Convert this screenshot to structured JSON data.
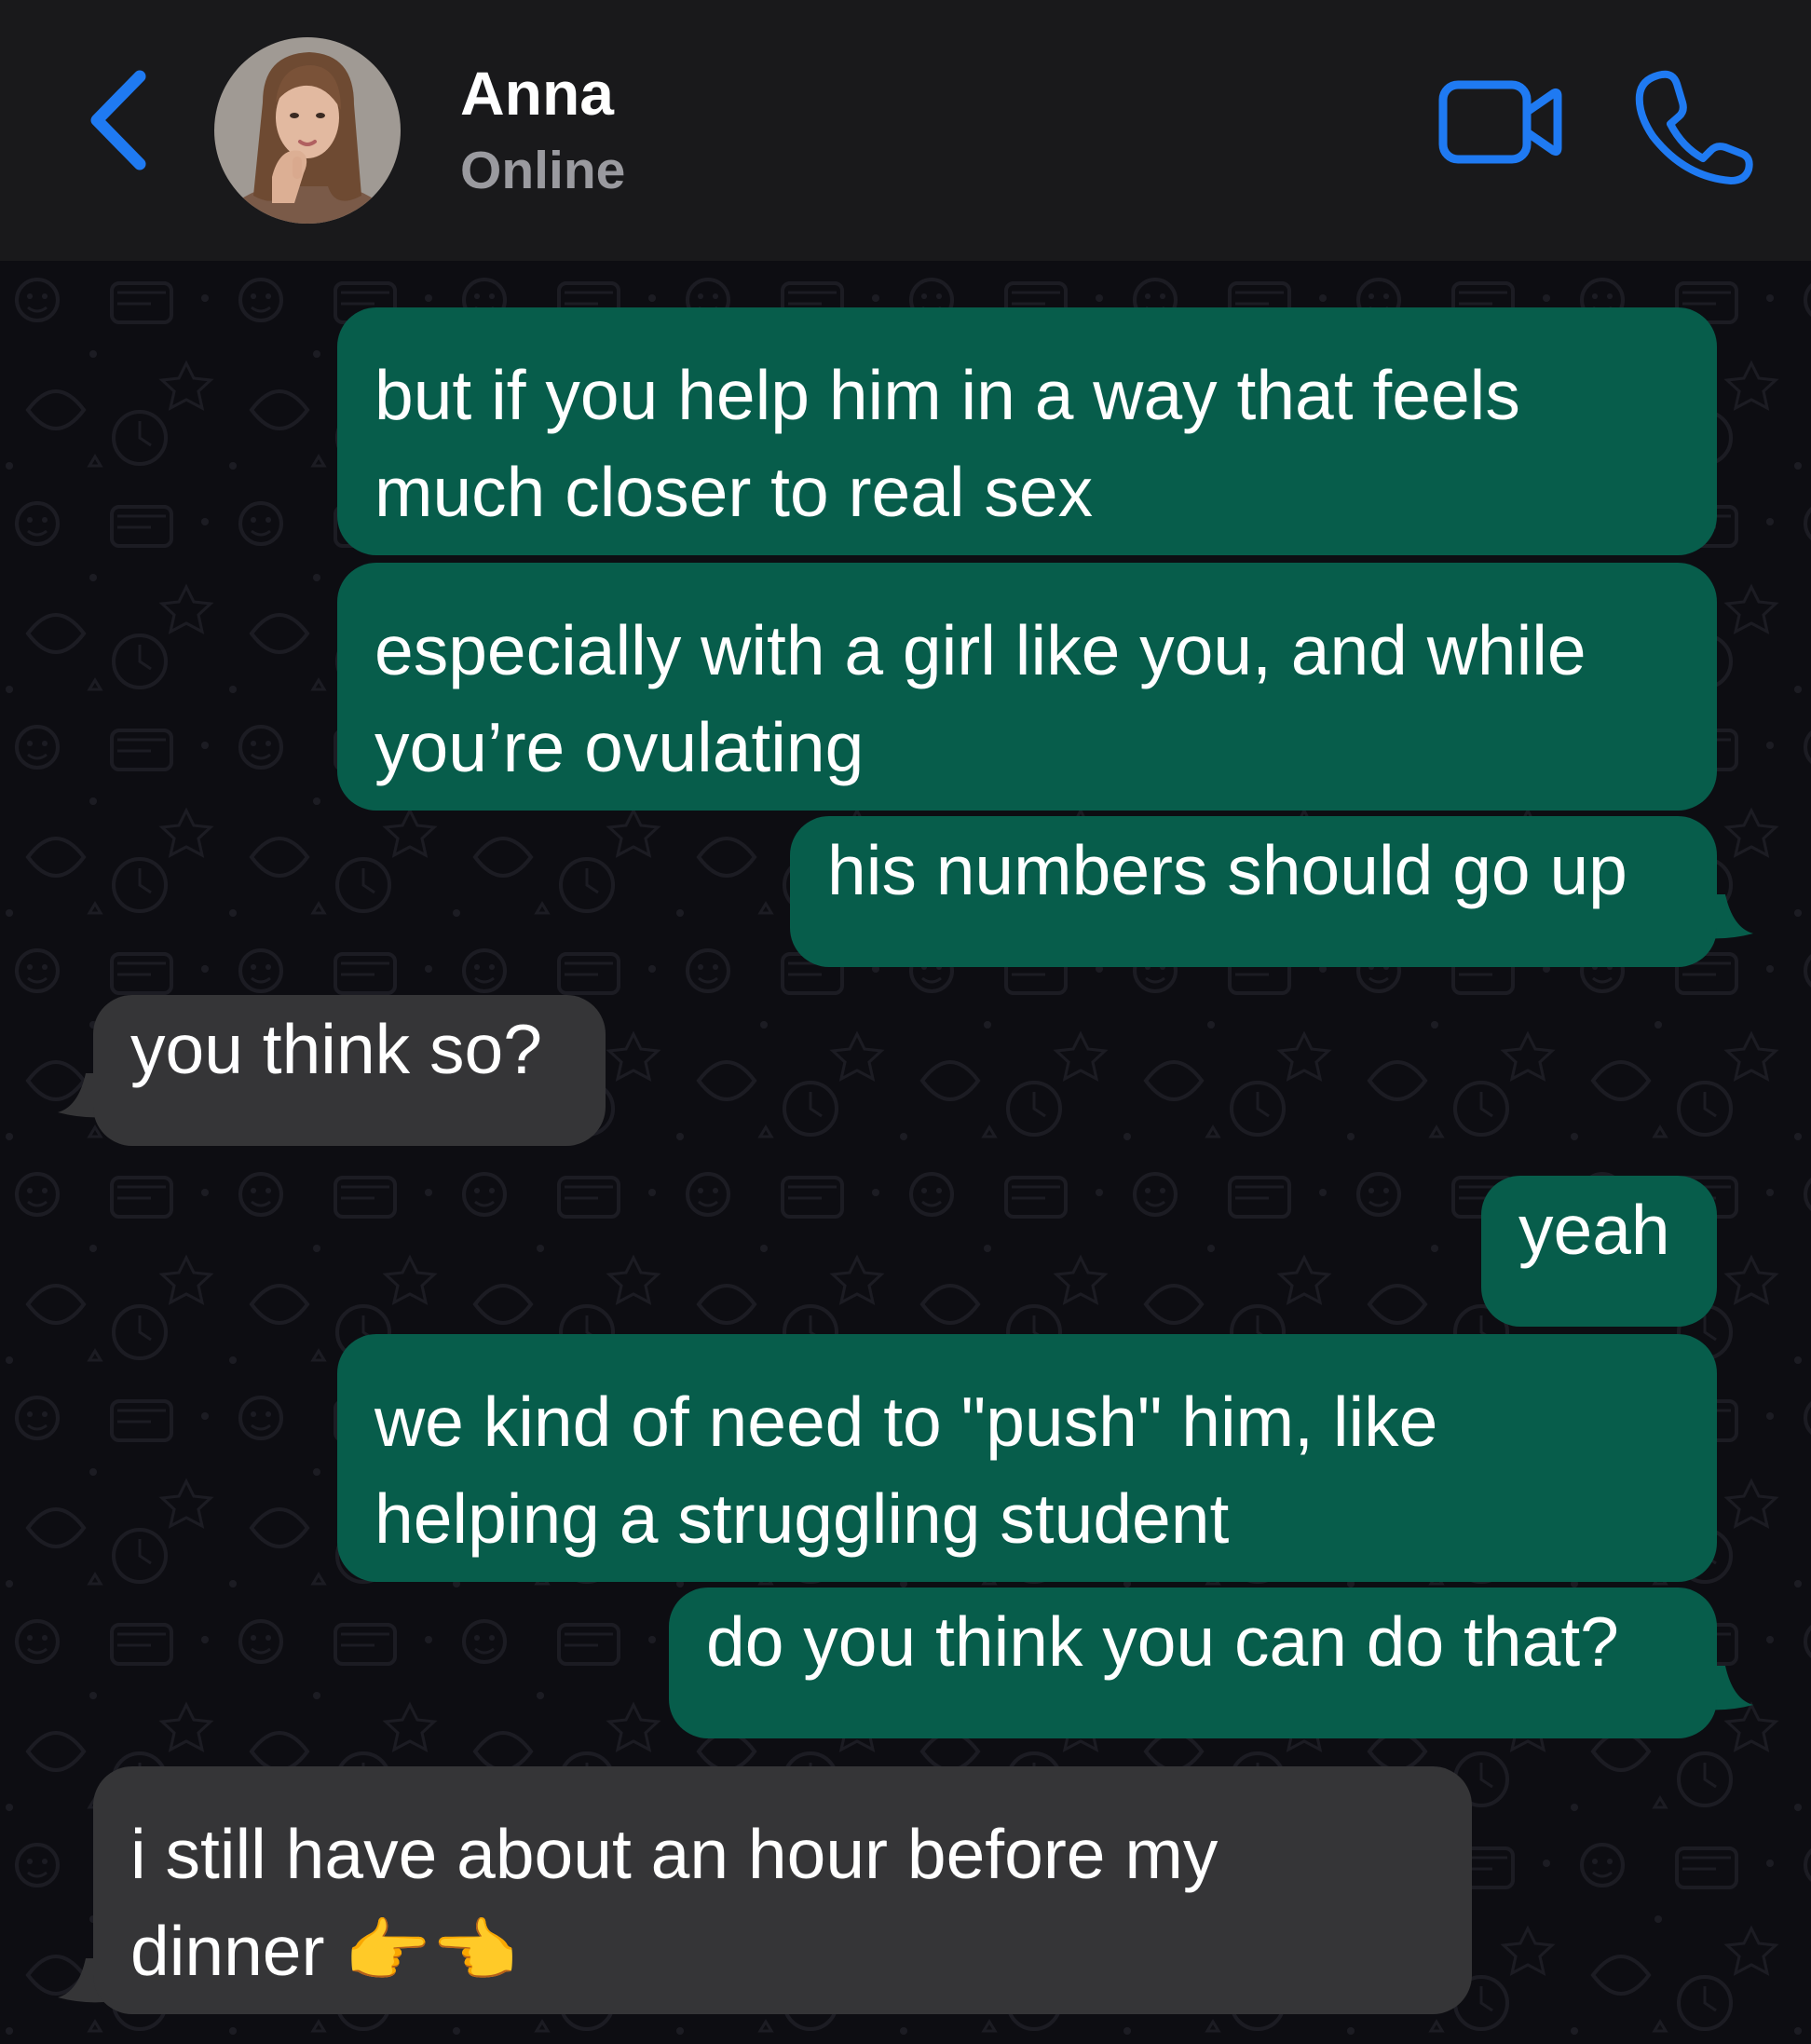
{
  "header": {
    "contact_name": "Anna",
    "status": "Online",
    "back_icon": "chevron-left-icon",
    "video_icon": "video-camera-icon",
    "call_icon": "phone-icon"
  },
  "colors": {
    "header_bg": "#19191b",
    "chat_bg": "#0d0d12",
    "outgoing_bubble": "#075d4b",
    "incoming_bubble": "#353537",
    "accent_blue": "#1f7af2",
    "status_gray": "#9a9a9f"
  },
  "messages": [
    {
      "direction": "outgoing",
      "lines": [
        "but if you help him in a way that feels",
        "much closer to real sex"
      ]
    },
    {
      "direction": "outgoing",
      "lines": [
        "especially with a girl like you, and while",
        "you’re ovulating"
      ]
    },
    {
      "direction": "outgoing",
      "lines": [
        "his numbers should go up"
      ]
    },
    {
      "direction": "incoming",
      "lines": [
        "you think so?"
      ]
    },
    {
      "direction": "outgoing",
      "lines": [
        "yeah"
      ]
    },
    {
      "direction": "outgoing",
      "lines": [
        "we kind of need to \"push\" him, like",
        "helping a struggling student"
      ]
    },
    {
      "direction": "outgoing",
      "lines": [
        "do you think you can do that?"
      ]
    },
    {
      "direction": "incoming",
      "lines": [
        "i still have about an hour before my",
        "dinner 👉👈"
      ]
    }
  ]
}
